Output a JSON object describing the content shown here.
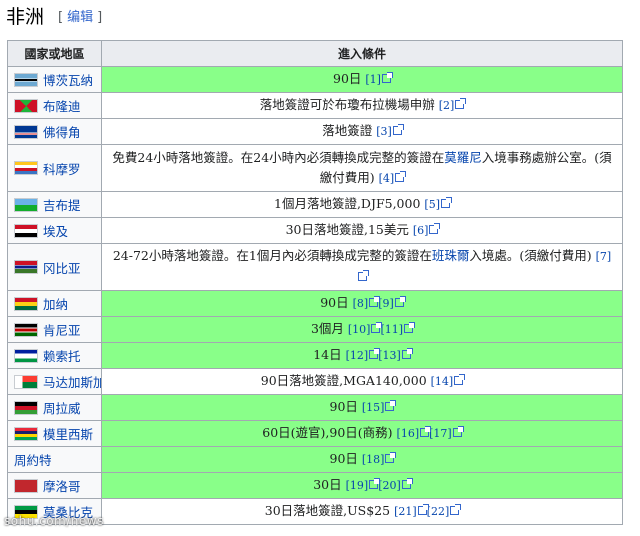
{
  "heading": {
    "title": "非洲",
    "edit_open": "[",
    "edit_label": "编辑",
    "edit_close": "]"
  },
  "table": {
    "headers": [
      "國家或地區",
      "進入條件"
    ],
    "rows": [
      {
        "country": "博茨瓦纳",
        "flag": "botswana-flag-icon",
        "bg": "green",
        "parts": [
          {
            "t": "90日 "
          },
          {
            "r": "[1]"
          }
        ]
      },
      {
        "country": "布隆迪",
        "flag": "burundi-flag-icon",
        "bg": "white",
        "parts": [
          {
            "t": "落地簽證可於布瓊布拉機場申辦 "
          },
          {
            "r": "[2]"
          }
        ]
      },
      {
        "country": "佛得角",
        "flag": "cape-verde-flag-icon",
        "bg": "white",
        "parts": [
          {
            "t": "落地簽證 "
          },
          {
            "r": "[3]"
          }
        ]
      },
      {
        "country": "科摩罗",
        "flag": "comoros-flag-icon",
        "bg": "white",
        "parts": [
          {
            "t": "免費24小時落地簽證。在24小時內必須轉換成完整的簽證在"
          },
          {
            "l": "莫羅尼"
          },
          {
            "t": "入境事務處辦公室。(須繳付費用) "
          },
          {
            "r": "[4]"
          }
        ]
      },
      {
        "country": "吉布提",
        "flag": "djibouti-flag-icon",
        "bg": "white",
        "parts": [
          {
            "t": "1個月落地簽證,DJF5,000 "
          },
          {
            "r": "[5]"
          }
        ]
      },
      {
        "country": "埃及",
        "flag": "egypt-flag-icon",
        "bg": "white",
        "parts": [
          {
            "t": "30日落地簽證,15美元 "
          },
          {
            "r": "[6]"
          }
        ]
      },
      {
        "country": "冈比亚",
        "flag": "gambia-flag-icon",
        "bg": "white",
        "parts": [
          {
            "t": "24-72小時落地簽證。在1個月內必須轉換成完整的簽證在"
          },
          {
            "l": "班珠爾"
          },
          {
            "t": "入境處。(須繳付費用) "
          },
          {
            "r": "[7]"
          }
        ]
      },
      {
        "country": "加纳",
        "flag": "ghana-flag-icon",
        "bg": "green",
        "parts": [
          {
            "t": "90日 "
          },
          {
            "r": "[8]"
          },
          {
            "r": "[9]"
          }
        ]
      },
      {
        "country": "肯尼亚",
        "flag": "kenya-flag-icon",
        "bg": "green",
        "parts": [
          {
            "t": "3個月 "
          },
          {
            "r": "[10]"
          },
          {
            "r": "[11]"
          }
        ]
      },
      {
        "country": "赖索托",
        "flag": "lesotho-flag-icon",
        "bg": "green",
        "parts": [
          {
            "t": "14日 "
          },
          {
            "r": "[12]"
          },
          {
            "r": "[13]"
          }
        ]
      },
      {
        "country": "马达加斯加",
        "flag": "madagascar-flag-icon",
        "bg": "white",
        "parts": [
          {
            "t": "90日落地簽證,MGA140,000 "
          },
          {
            "r": "[14]"
          }
        ]
      },
      {
        "country": "周拉威",
        "flag": "malawi-flag-icon",
        "bg": "green",
        "parts": [
          {
            "t": "90日 "
          },
          {
            "r": "[15]"
          }
        ]
      },
      {
        "country": "模里西斯",
        "flag": "mauritius-flag-icon",
        "bg": "green",
        "parts": [
          {
            "t": "60日(遊官),90日(商務) "
          },
          {
            "r": "[16]"
          },
          {
            "r": "[17]"
          }
        ]
      },
      {
        "country": "周約特",
        "flag": "",
        "bg": "green",
        "parts": [
          {
            "t": "90日 "
          },
          {
            "r": "[18]"
          }
        ]
      },
      {
        "country": "摩洛哥",
        "flag": "morocco-flag-icon",
        "bg": "green",
        "parts": [
          {
            "t": "30日 "
          },
          {
            "r": "[19]"
          },
          {
            "r": "[20]"
          }
        ]
      },
      {
        "country": "莫桑比克",
        "flag": "mozambique-flag-icon",
        "bg": "white",
        "parts": [
          {
            "t": "30日落地簽證,US$25 "
          },
          {
            "r": "[21]"
          },
          {
            "r": "[22]"
          }
        ]
      }
    ]
  },
  "colors": {
    "green": "#89ff89",
    "white": "#ffffff",
    "header": "#eaecf0",
    "link": "#0645ad"
  },
  "watermark": "sohu.com/news"
}
